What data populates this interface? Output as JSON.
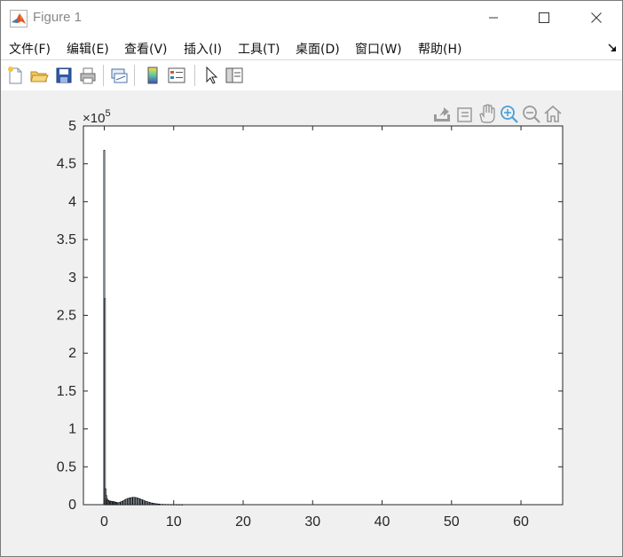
{
  "window": {
    "title": "Figure 1",
    "controls": {
      "minimize": "minimize",
      "maximize": "maximize",
      "close": "close"
    }
  },
  "menu": {
    "items": [
      "文件(F)",
      "编辑(E)",
      "查看(V)",
      "插入(I)",
      "工具(T)",
      "桌面(D)",
      "窗口(W)",
      "帮助(H)"
    ],
    "overflow_icon": "dock-arrow-icon"
  },
  "toolbar": {
    "buttons": [
      "new-figure-icon",
      "open-file-icon",
      "save-icon",
      "print-icon",
      "link-plot-icon",
      "insert-colorbar-icon",
      "insert-legend-icon",
      "edit-plot-icon",
      "property-inspector-icon"
    ]
  },
  "axes_toolbar": {
    "buttons": [
      "export-icon",
      "brush-data-icon",
      "pan-icon",
      "zoom-in-icon",
      "zoom-out-icon",
      "restore-view-icon"
    ]
  },
  "colors": {
    "bar_fill": "#c9d9ea",
    "bar_edge": "#000000",
    "axes_bg": "#ffffff",
    "figure_bg": "#f0f0f0"
  },
  "chart_data": {
    "type": "bar",
    "title": "",
    "xlabel": "",
    "ylabel": "",
    "exponent_label": "×10",
    "exponent_power": "5",
    "xlim": [
      -3,
      66
    ],
    "ylim": [
      0,
      500000
    ],
    "xticks": [
      "0",
      "10",
      "20",
      "30",
      "40",
      "50",
      "60"
    ],
    "yticks": [
      "0",
      "0.5",
      "1",
      "1.5",
      "2",
      "2.5",
      "3",
      "3.5",
      "4",
      "4.5",
      "5"
    ],
    "bar_width": 0.1,
    "x": [
      0,
      0.1,
      0.2,
      0.3,
      0.4,
      0.5,
      0.6,
      0.7,
      0.8,
      0.9,
      1.0,
      1.1,
      1.2,
      1.3,
      1.4,
      1.5,
      1.6,
      1.7,
      1.8,
      1.9,
      2.0,
      2.2,
      2.4,
      2.6,
      2.8,
      3.0,
      3.2,
      3.4,
      3.6,
      3.8,
      4.0,
      4.2,
      4.4,
      4.6,
      4.8,
      5.0,
      5.2,
      5.4,
      5.6,
      5.8,
      6.0,
      6.2,
      6.4,
      6.6,
      6.8,
      7.0,
      7.2,
      7.4,
      7.6,
      7.8,
      8.0,
      8.4,
      8.8,
      9.2,
      9.6,
      10.0,
      10.4,
      10.8,
      11.2
    ],
    "values": [
      468000,
      272000,
      21000,
      12000,
      8000,
      6000,
      5500,
      5000,
      4800,
      4600,
      4500,
      4300,
      4200,
      4000,
      3800,
      3600,
      3300,
      3000,
      2800,
      2600,
      2500,
      3000,
      3800,
      4500,
      5500,
      6500,
      7500,
      8200,
      8800,
      9200,
      9500,
      9700,
      9600,
      9300,
      8800,
      8200,
      7500,
      6800,
      6000,
      5200,
      4500,
      3900,
      3300,
      2800,
      2300,
      1900,
      1600,
      1300,
      1100,
      900,
      800,
      600,
      450,
      350,
      280,
      220,
      170,
      130,
      90
    ]
  }
}
